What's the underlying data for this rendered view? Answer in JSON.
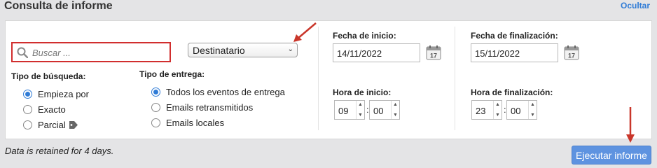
{
  "header": {
    "title": "Consulta de informe",
    "hide_link": "Ocultar"
  },
  "search": {
    "placeholder": "Buscar ...",
    "value": ""
  },
  "recipient_select": {
    "selected": "Destinatario"
  },
  "search_type": {
    "label": "Tipo de búsqueda:",
    "options": [
      "Empieza por",
      "Exacto",
      "Parcial"
    ],
    "selected_index": 0
  },
  "delivery_type": {
    "label": "Tipo de entrega:",
    "options": [
      "Todos los eventos de entrega",
      "Emails retransmitidos",
      "Emails locales"
    ],
    "selected_index": 0
  },
  "start": {
    "date_label": "Fecha de inicio:",
    "date_value": "14/11/2022",
    "time_label": "Hora de inicio:",
    "hour": "09",
    "minute": "00"
  },
  "end": {
    "date_label": "Fecha de finalización:",
    "date_value": "15/11/2022",
    "time_label": "Hora de finalización:",
    "hour": "23",
    "minute": "00"
  },
  "calendar_day": "17",
  "footer": {
    "note": "Data is retained for 4 days.",
    "run_button": "Ejecutar informe"
  },
  "colors": {
    "accent": "#2f7bd6",
    "highlight_red": "#d12e2e",
    "button": "#5e93e0"
  }
}
